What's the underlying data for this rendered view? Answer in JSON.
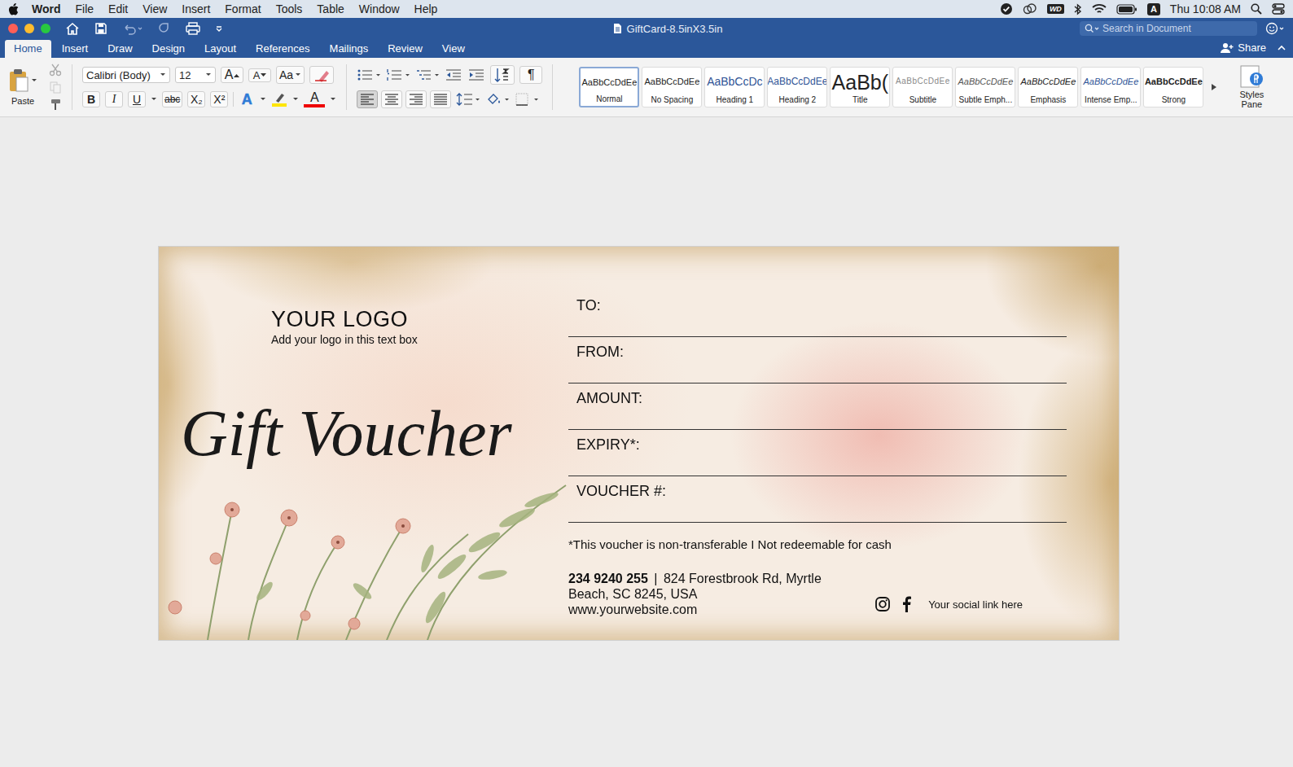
{
  "menubar": {
    "app": "Word",
    "items": [
      "File",
      "Edit",
      "View",
      "Insert",
      "Format",
      "Tools",
      "Table",
      "Window",
      "Help"
    ],
    "wd": "WD",
    "input": "A",
    "clock": "Thu 10:08 AM"
  },
  "window": {
    "title": "GiftCard-8.5inX3.5in",
    "search": {
      "placeholder": "Search in Document"
    }
  },
  "tabs": [
    {
      "label": "Home",
      "selected": true
    },
    {
      "label": "Insert",
      "selected": false
    },
    {
      "label": "Draw",
      "selected": false
    },
    {
      "label": "Design",
      "selected": false
    },
    {
      "label": "Layout",
      "selected": false
    },
    {
      "label": "References",
      "selected": false
    },
    {
      "label": "Mailings",
      "selected": false
    },
    {
      "label": "Review",
      "selected": false
    },
    {
      "label": "View",
      "selected": false
    }
  ],
  "share": "Share",
  "ribbon": {
    "paste": "Paste",
    "font": "Calibri (Body)",
    "size": "12",
    "grow": "A",
    "shrink": "A",
    "change_case": "Aa",
    "format_buttons": [
      "B",
      "I",
      "U",
      "abc",
      "X₂",
      "X²"
    ],
    "text_effects": "A",
    "font_color": "A",
    "pilcrow": "¶",
    "alignments": [
      {
        "selected": true
      },
      {
        "selected": false
      },
      {
        "selected": false
      },
      {
        "selected": false
      }
    ],
    "styles": [
      {
        "preview": "AaBbCcDdEe",
        "label": "Normal",
        "selected": true
      },
      {
        "preview": "AaBbCcDdEe",
        "label": "No Spacing",
        "selected": false
      },
      {
        "preview": "AaBbCcDc",
        "label": "Heading 1",
        "selected": false
      },
      {
        "preview": "AaBbCcDdEe",
        "label": "Heading 2",
        "selected": false
      },
      {
        "preview": "AaBb(",
        "label": "Title",
        "selected": false
      },
      {
        "preview": "AaBbCcDdEe",
        "label": "Subtitle",
        "selected": false
      },
      {
        "preview": "AaBbCcDdEe",
        "label": "Subtle Emph...",
        "selected": false
      },
      {
        "preview": "AaBbCcDdEe",
        "label": "Emphasis",
        "selected": false
      },
      {
        "preview": "AaBbCcDdEe",
        "label": "Intense Emp...",
        "selected": false
      },
      {
        "preview": "AaBbCcDdEe",
        "label": "Strong",
        "selected": false
      }
    ],
    "styles_pane": "Styles Pane"
  },
  "card": {
    "logo_title": "YOUR LOGO",
    "logo_hint": "Add your logo in this text box",
    "heading": "Gift Voucher",
    "fields": [
      "TO:",
      "FROM:",
      "AMOUNT:",
      "EXPIRY*:",
      "VOUCHER #:"
    ],
    "note": "*This voucher is non-transferable I Not redeemable for cash",
    "phone": "234 9240 255",
    "separator": "|",
    "address_lines": [
      "824 Forestbrook Rd, Myrtle",
      "Beach, SC 8245, USA"
    ],
    "website": "www.yourwebsite.com",
    "social": "Your social link here"
  }
}
